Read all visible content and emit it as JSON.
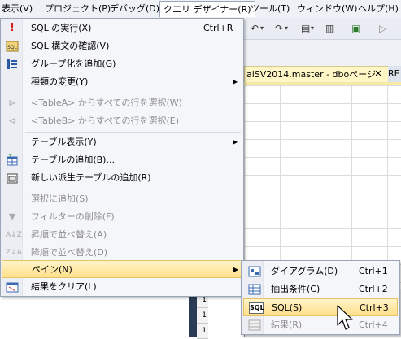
{
  "menubar": {
    "items": [
      "表示(V)",
      "プロジェクト(P)",
      "デバッグ(D)",
      "クエリ デザイナー(R)",
      "ツール(T)",
      "ウィンドウ(W)",
      "ヘルプ(H)"
    ]
  },
  "document": {
    "tab_title": "alSV2014.master - dboページ",
    "tab_close": "✕",
    "next_tab": "RF"
  },
  "menu": {
    "items": [
      {
        "label": "SQL の実行(X)",
        "shortcut": "Ctrl+R",
        "icon": "exclamation-icon"
      },
      {
        "label": "SQL 構文の確認(V)",
        "icon": "sql-check-icon"
      },
      {
        "label": "グループ化を追加(G)",
        "icon": "group-by-icon"
      },
      {
        "label": "種類の変更(Y)",
        "submenu": true
      },
      {
        "label": "<TableA> からすべての行を選択(W)",
        "disabled": true,
        "icon": "join-left-icon"
      },
      {
        "label": "<TableB> からすべての行を選択(E)",
        "disabled": true,
        "icon": "join-right-icon"
      },
      {
        "label": "テーブル表示(Y)",
        "submenu": true
      },
      {
        "label": "テーブルの追加(B)...",
        "icon": "add-table-icon"
      },
      {
        "label": "新しい派生テーブルの追加(R)",
        "icon": "derived-table-icon"
      },
      {
        "label": "選択に追加(S)",
        "disabled": true
      },
      {
        "label": "フィルターの削除(F)",
        "disabled": true,
        "icon": "filter-icon"
      },
      {
        "label": "昇順で並べ替え(A)",
        "disabled": true,
        "icon": "sort-ascending-icon"
      },
      {
        "label": "降順で並べ替え(D)",
        "disabled": true,
        "icon": "sort-descending-icon"
      },
      {
        "label": "ペイン(N)",
        "submenu": true,
        "highlighted": true
      },
      {
        "label": "結果をクリア(L)",
        "icon": "clear-results-icon"
      }
    ]
  },
  "submenu": {
    "items": [
      {
        "label": "ダイアグラム(D)",
        "shortcut": "Ctrl+1",
        "icon": "diagram-icon"
      },
      {
        "label": "抽出条件(C)",
        "shortcut": "Ctrl+2",
        "icon": "criteria-icon"
      },
      {
        "label": "SQL(S)",
        "shortcut": "Ctrl+3",
        "icon": "sql-icon",
        "icon_text": "SQL",
        "highlighted": true
      },
      {
        "label": "結果(R)",
        "shortcut": "Ctrl+4",
        "icon": "results-icon",
        "disabled": true
      }
    ]
  },
  "arrow_glyph": "▶",
  "colors": {
    "highlight_top": "#fff4c9",
    "highlight_bottom": "#ffe08a",
    "disabled_text": "#8d8d8d",
    "menu_bg": "#f5f6f9"
  }
}
